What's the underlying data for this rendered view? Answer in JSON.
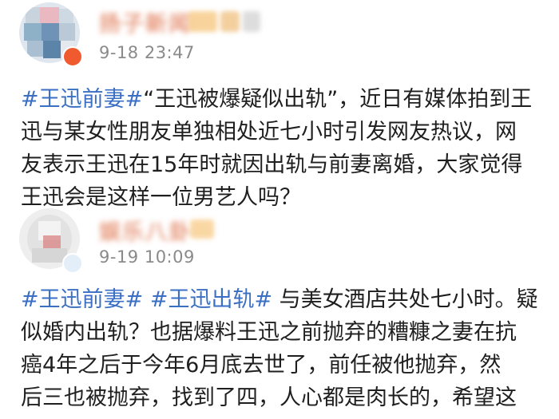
{
  "posts": [
    {
      "username": "扬子新闻",
      "time": "9-18 23:47",
      "tag": "#王迅前妻#",
      "lines": [
        "“王迅被爆疑似出轨”，近日有媒体拍到王",
        "迅与某女性朋友单独相处近七小时引发网友热议，网",
        "友表示王迅在15年时就因出轨与前妻离婚，大家觉得",
        "王迅会是这样一位男艺人吗？"
      ]
    },
    {
      "username": "娱乐八卦",
      "time": "9-19 10:09",
      "tag1": "#王迅前妻#",
      "tag2": "#王迅出轨#",
      "lines": [
        " 与美女酒店共处七小时。疑",
        "似婚内出轨？也据爆料王迅之前抛弃的糟糠之妻在抗",
        "癌4年之后于今年6月底去世了，前任被他抛弃，然",
        "后三也被抛弃，找到了四，人心都是肉长的，希望这"
      ]
    }
  ],
  "colors": {
    "hashtag": "#3a6fc4",
    "time": "#8a8a8a",
    "text": "#1f1f1f"
  }
}
